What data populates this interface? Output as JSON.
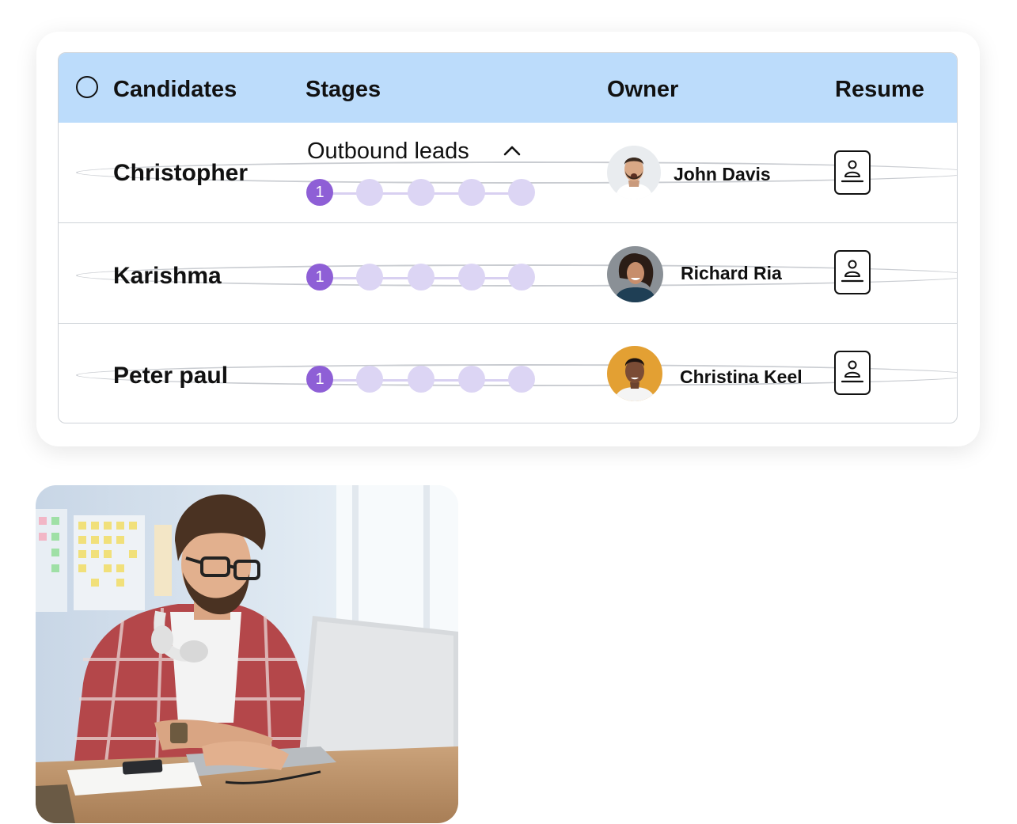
{
  "table": {
    "headers": {
      "candidates": "Candidates",
      "stages": "Stages",
      "owner": "Owner",
      "resume": "Resume"
    },
    "rows": [
      {
        "candidate": "Christopher",
        "stage_label": "Outbound leads",
        "stage_expanded": true,
        "current_step": "1",
        "total_steps": 5,
        "owner": "John Davis",
        "avatar_bg": "#e9ecef"
      },
      {
        "candidate": "Karishma",
        "stage_label": "",
        "current_step": "1",
        "total_steps": 5,
        "owner": "Richard Ria",
        "avatar_bg": "#8a9096"
      },
      {
        "candidate": "Peter paul",
        "stage_label": "",
        "current_step": "1",
        "total_steps": 5,
        "owner": "Christina Keel",
        "avatar_bg": "#e3a033"
      }
    ]
  },
  "colors": {
    "header_bg": "#bcdcfb",
    "step_active": "#8e5fd6",
    "step_inactive": "#dcd5f4",
    "border": "#cfd3d8"
  },
  "icons": {
    "select_all": "radio-icon",
    "row_select": "radio-icon",
    "collapse": "chevron-up-icon",
    "resume": "resume-document-icon"
  }
}
